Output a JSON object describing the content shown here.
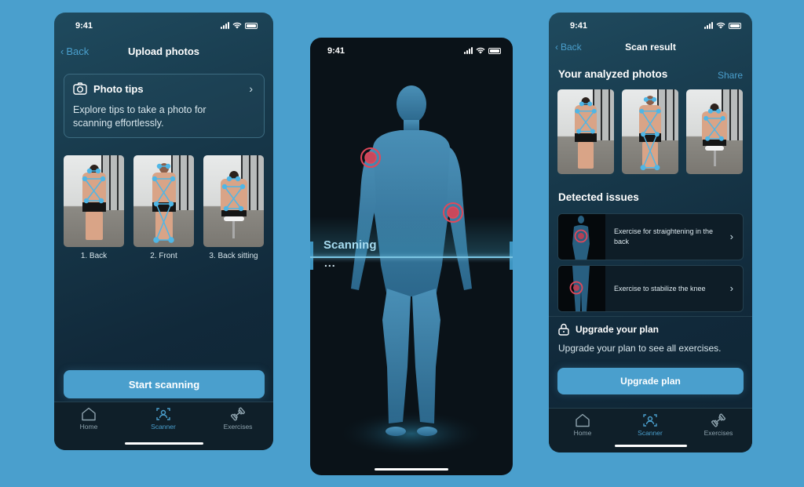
{
  "background_color": "#4a9fcd",
  "accent_color": "#4a9fcd",
  "screens": [
    {
      "id": "upload",
      "status_time": "9:41",
      "nav": {
        "back_label": "Back",
        "title": "Upload photos"
      },
      "tips_card": {
        "icon": "camera-icon",
        "title": "Photo tips",
        "description": "Explore tips to take a photo for scanning effortlessly."
      },
      "photos": [
        {
          "label": "1. Back",
          "pose": "back"
        },
        {
          "label": "2. Front",
          "pose": "front"
        },
        {
          "label": "3. Back sitting",
          "pose": "sitting"
        }
      ],
      "primary_button": "Start scanning",
      "tabs": [
        {
          "label": "Home",
          "icon": "home-icon",
          "active": false
        },
        {
          "label": "Scanner",
          "icon": "scanner-icon",
          "active": true
        },
        {
          "label": "Exercises",
          "icon": "dumbbell-icon",
          "active": false
        }
      ]
    },
    {
      "id": "scanning",
      "status_time": "9:41",
      "scan_label": "Scanning",
      "scan_progress_dots": "...",
      "hotspots": [
        "right-shoulder",
        "left-elbow"
      ]
    },
    {
      "id": "result",
      "status_time": "9:41",
      "nav": {
        "back_label": "Back",
        "title": "Scan result"
      },
      "photos_section": {
        "title": "Your analyzed photos",
        "action": "Share"
      },
      "issues_section": {
        "title": "Detected issues",
        "items": [
          {
            "label": "Exercise for straightening in the back",
            "hotspot": "back"
          },
          {
            "label": "Exercise to stabilize the knee",
            "hotspot": "knee"
          }
        ]
      },
      "upgrade": {
        "icon": "lock-icon",
        "title": "Upgrade your plan",
        "description": "Upgrade your plan to see all exercises.",
        "button": "Upgrade plan"
      },
      "tabs": [
        {
          "label": "Home",
          "icon": "home-icon",
          "active": false
        },
        {
          "label": "Scanner",
          "icon": "scanner-icon",
          "active": true
        },
        {
          "label": "Exercises",
          "icon": "dumbbell-icon",
          "active": false
        }
      ]
    }
  ]
}
